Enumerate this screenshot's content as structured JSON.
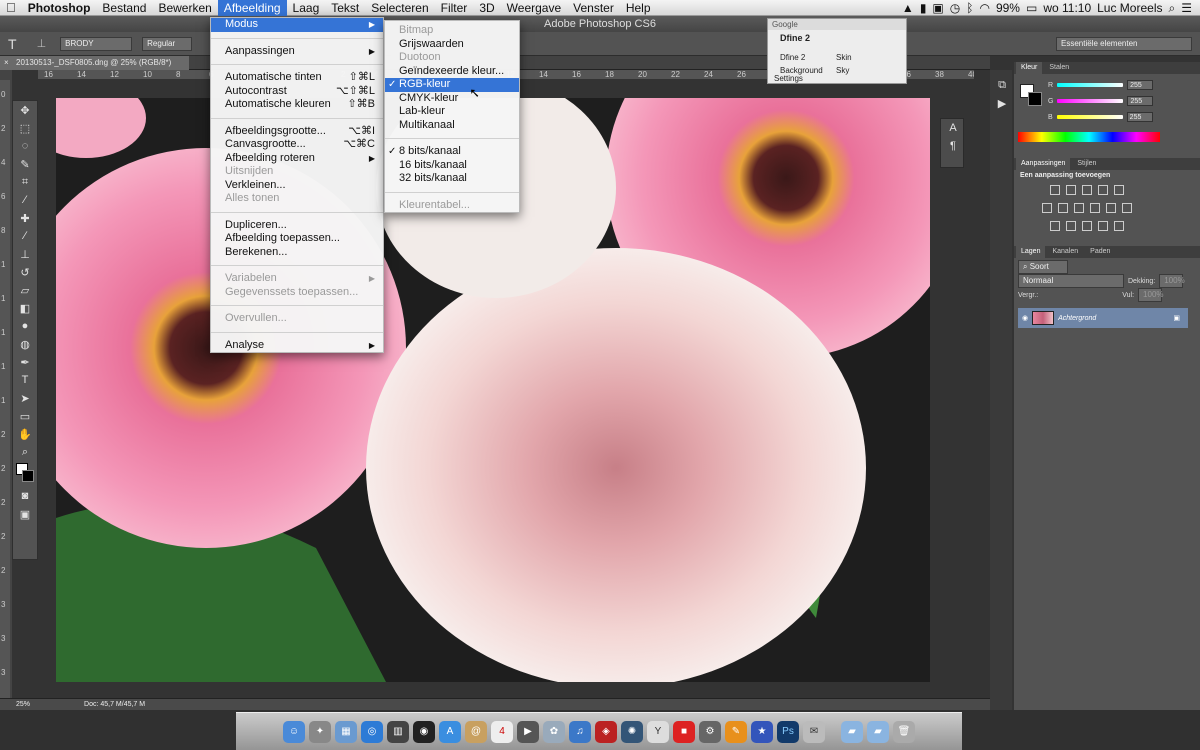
{
  "menubar": {
    "apple": "",
    "app": "Photoshop",
    "items": [
      "Bestand",
      "Bewerken",
      "Afbeelding",
      "Laag",
      "Tekst",
      "Selecteren",
      "Filter",
      "3D",
      "Weergave",
      "Venster",
      "Help"
    ],
    "active_index": 2,
    "battery": "99%",
    "clock": "wo 11:10",
    "user": "Luc Moreels"
  },
  "window": {
    "title": "Adobe Photoshop CS6"
  },
  "options": {
    "font_family": "BRODY",
    "font_style": "Regular",
    "workspace": "Essentiële elementen"
  },
  "document": {
    "tab": "20130513-_DSF0805.dng @ 25% (RGB/8*)",
    "zoom": "25%",
    "doc_size": "Doc: 45,7 M/45,7 M"
  },
  "ruler": {
    "h": [
      "16",
      "14",
      "12",
      "10",
      "8",
      "6",
      "4",
      "2",
      "0",
      "2",
      "4",
      "6",
      "8",
      "10",
      "12",
      "14",
      "16",
      "18",
      "20",
      "22",
      "24",
      "26",
      "28",
      "30",
      "32",
      "34",
      "36",
      "38",
      "40"
    ],
    "v": [
      "0",
      "2",
      "4",
      "6",
      "8",
      "1",
      "1",
      "1",
      "1",
      "1",
      "2",
      "2",
      "2",
      "2",
      "2",
      "3",
      "3",
      "3"
    ]
  },
  "menu_afbeelding": {
    "groups": [
      [
        {
          "label": "Modus",
          "submenu": true,
          "selected": true
        }
      ],
      [
        {
          "label": "Aanpassingen",
          "submenu": true
        }
      ],
      [
        {
          "label": "Automatische tinten",
          "shortcut": "⇧⌘L"
        },
        {
          "label": "Autocontrast",
          "shortcut": "⌥⇧⌘L"
        },
        {
          "label": "Automatische kleuren",
          "shortcut": "⇧⌘B"
        }
      ],
      [
        {
          "label": "Afbeeldingsgrootte...",
          "shortcut": "⌥⌘I"
        },
        {
          "label": "Canvasgrootte...",
          "shortcut": "⌥⌘C"
        },
        {
          "label": "Afbeelding roteren",
          "submenu": true
        },
        {
          "label": "Uitsnijden",
          "disabled": true
        },
        {
          "label": "Verkleinen..."
        },
        {
          "label": "Alles tonen",
          "disabled": true
        }
      ],
      [
        {
          "label": "Dupliceren..."
        },
        {
          "label": "Afbeelding toepassen..."
        },
        {
          "label": "Berekenen..."
        }
      ],
      [
        {
          "label": "Variabelen",
          "submenu": true,
          "disabled": true
        },
        {
          "label": "Gegevenssets toepassen...",
          "disabled": true
        }
      ],
      [
        {
          "label": "Overvullen...",
          "disabled": true
        }
      ],
      [
        {
          "label": "Analyse",
          "submenu": true
        }
      ]
    ]
  },
  "menu_modus": {
    "groups": [
      [
        {
          "label": "Bitmap",
          "disabled": true
        },
        {
          "label": "Grijswaarden"
        },
        {
          "label": "Duotoon",
          "disabled": true
        },
        {
          "label": "Geïndexeerde kleur..."
        },
        {
          "label": "RGB-kleur",
          "checked": true,
          "selected": true
        },
        {
          "label": "CMYK-kleur"
        },
        {
          "label": "Lab-kleur"
        },
        {
          "label": "Multikanaal"
        }
      ],
      [
        {
          "label": "8 bits/kanaal",
          "checked": true
        },
        {
          "label": "16 bits/kanaal"
        },
        {
          "label": "32 bits/kanaal"
        }
      ],
      [
        {
          "label": "Kleurentabel...",
          "disabled": true
        }
      ]
    ]
  },
  "google_widget": {
    "title": "Google",
    "heading": "Dfine 2",
    "c1": "Dfine 2",
    "c2": "Skin",
    "c3": "Background",
    "c4": "Sky",
    "settings": "Settings"
  },
  "panels": {
    "color": {
      "tabs": [
        "Kleur",
        "Stalen"
      ],
      "r": "255",
      "g": "255",
      "b": "255",
      "r_label": "R",
      "g_label": "G",
      "b_label": "B"
    },
    "adjust": {
      "tabs": [
        "Aanpassingen",
        "Stijlen"
      ],
      "heading": "Een aanpassing toevoegen"
    },
    "layers": {
      "tabs": [
        "Lagen",
        "Kanalen",
        "Paden"
      ],
      "filter": "Soort",
      "blend": "Normaal",
      "opacity_label": "Dekking:",
      "opacity": "100%",
      "lock_label": "Vergr.:",
      "fill_label": "Vul:",
      "fill": "100%",
      "layer_name": "Achtergrond"
    }
  },
  "colors": {
    "accent": "#3574d6",
    "panel": "#535353"
  },
  "tools": [
    "move-icon",
    "marquee-icon",
    "lasso-icon",
    "quick-select-icon",
    "crop-icon",
    "eyedropper-icon",
    "healing-icon",
    "brush-icon",
    "stamp-icon",
    "history-brush-icon",
    "eraser-icon",
    "gradient-icon",
    "blur-icon",
    "dodge-icon",
    "pen-icon",
    "type-icon",
    "path-select-icon",
    "shape-icon",
    "hand-icon",
    "zoom-icon"
  ],
  "dock": [
    "finder-icon",
    "launchpad-icon",
    "preview-icon",
    "safari-icon",
    "photos-icon",
    "dvd-icon",
    "appstore-icon",
    "contacts-icon",
    "calendar-icon",
    "facetime-icon",
    "itunes-icon",
    "music-icon",
    "photobooth-icon",
    "books-icon",
    "3d-icon",
    "grab-icon",
    "ibooks-icon",
    "imovie-icon",
    "photoshop-icon",
    "script-icon",
    "folder-icon",
    "folder-icon",
    "trash-icon"
  ],
  "dock_ps_label": "Ps",
  "dock_cal_label": "4",
  "type_tool_label": "T"
}
